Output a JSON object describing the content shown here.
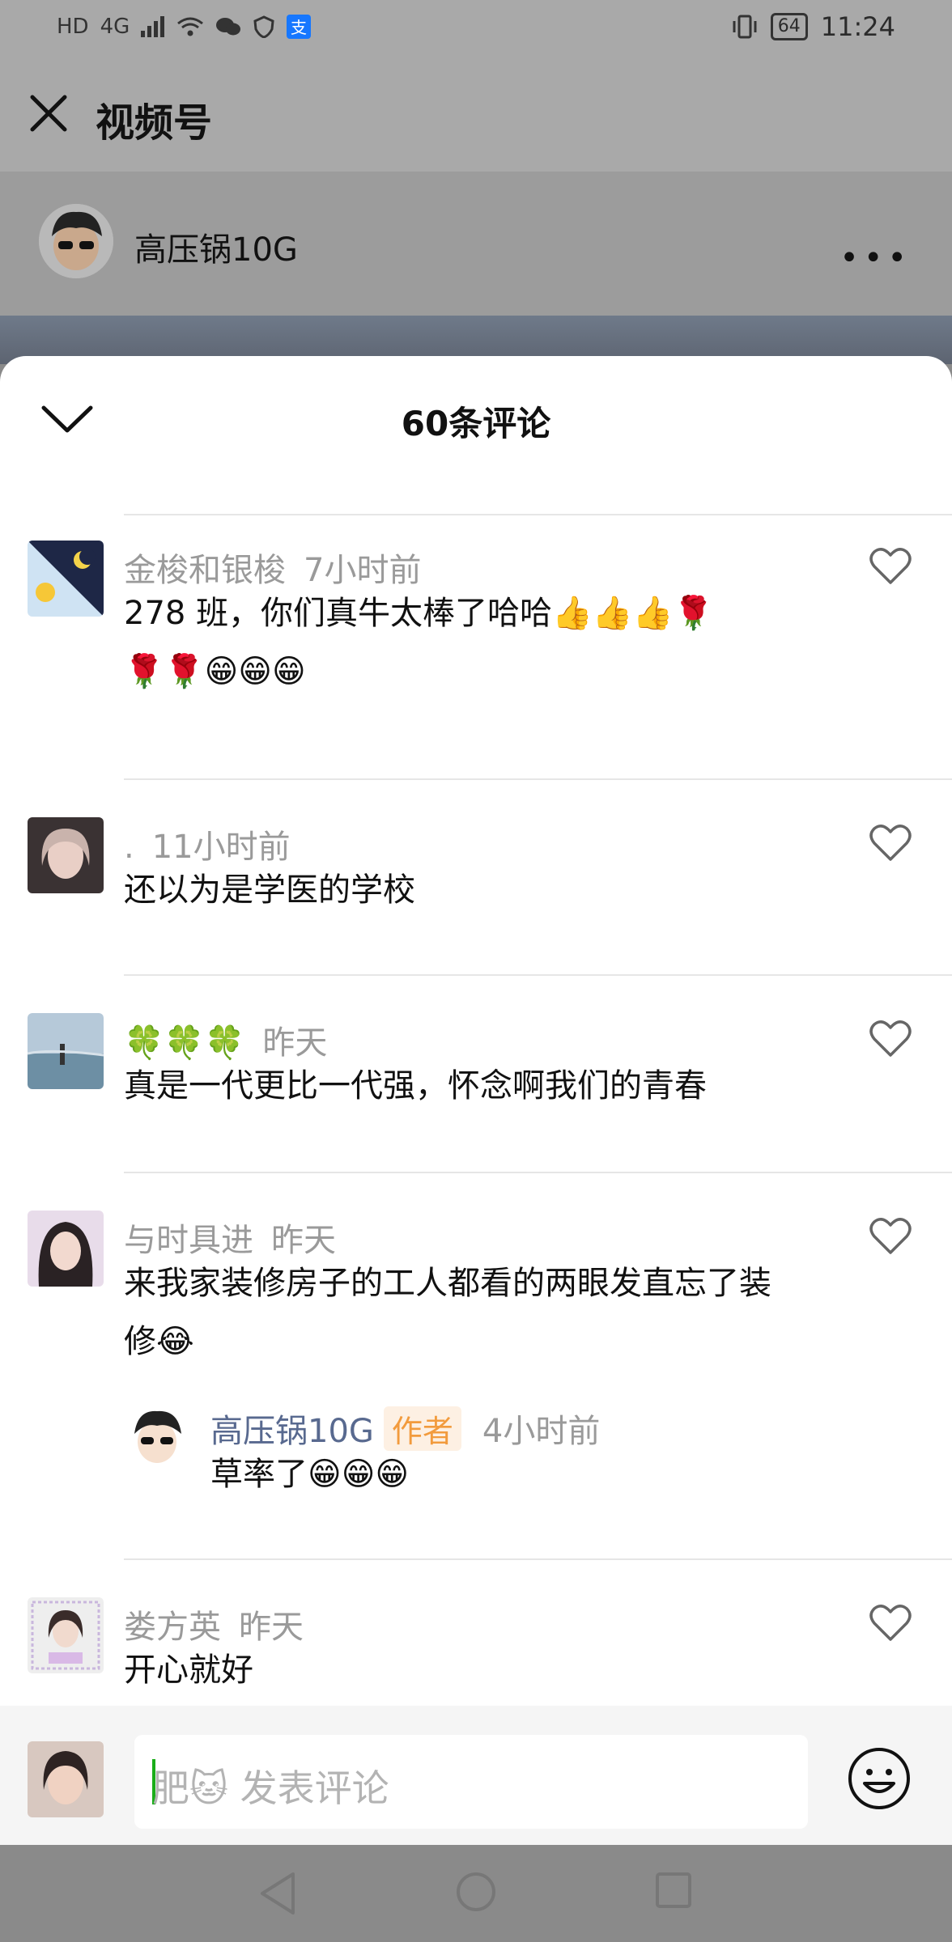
{
  "status": {
    "left_icons": [
      "HD",
      "4G",
      "signal-icon",
      "wifi-icon",
      "wechat-icon",
      "shield-icon",
      "alipay-icon"
    ],
    "hd": "HD",
    "net": "4G",
    "battery": "64",
    "time": "11:24"
  },
  "topbar": {
    "title": "视频号"
  },
  "author": {
    "name": "高压锅10G",
    "more": "•••"
  },
  "sheet": {
    "count_label": "60条评论"
  },
  "comments": [
    {
      "user": "金梭和银梭",
      "time": "7小时前",
      "text_line1": "278 班，你们真牛太棒了哈哈👍👍👍🌹",
      "text_line2": "🌹🌹😁😁😁"
    },
    {
      "user": ".",
      "time": "11小时前",
      "text": "还以为是学医的学校"
    },
    {
      "user": "🍀🍀🍀",
      "time": "昨天",
      "text": "真是一代更比一代强，怀念啊我们的青春"
    },
    {
      "user": "与时具进",
      "time": "昨天",
      "text_line1": "来我家装修房子的工人都看的两眼发直忘了装",
      "text_line2": "修😂",
      "reply": {
        "user": "高压锅10G",
        "badge": "作者",
        "time": "4小时前",
        "text": "草率了😁😁😁"
      }
    },
    {
      "user": "娄方英",
      "time": "昨天",
      "text": "开心就好"
    }
  ],
  "input": {
    "placeholder": "肥🐱 发表评论"
  },
  "colors": {
    "accent_green": "#1aad19",
    "author_name": "#58698f",
    "badge_text": "#f29b3d",
    "badge_bg": "#fdf0e3"
  }
}
